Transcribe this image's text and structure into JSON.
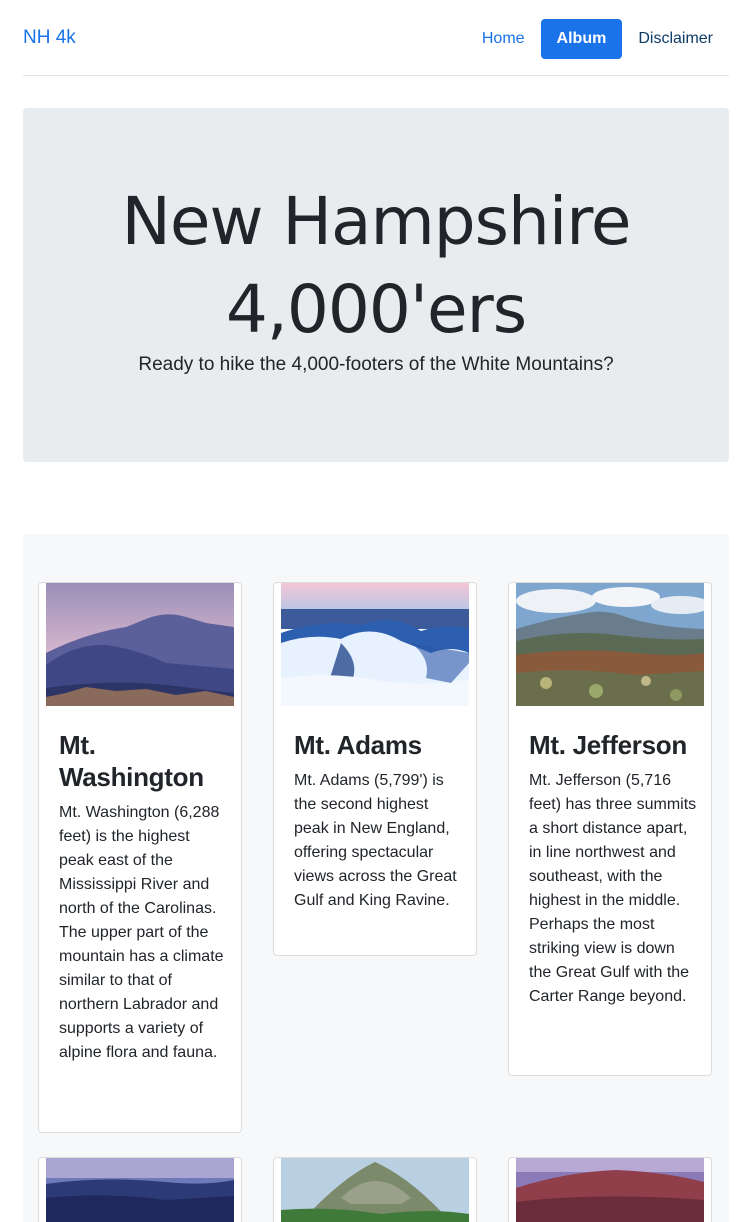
{
  "nav": {
    "brand": "NH 4k",
    "links": [
      {
        "label": "Home"
      },
      {
        "label": "Album"
      },
      {
        "label": "Disclaimer"
      }
    ],
    "active_link": "Album",
    "accent_color": "#1a73e8"
  },
  "hero": {
    "title_line1": "New Hampshire",
    "title_line2": "4,000'ers",
    "lead": "Ready to hike the 4,000-footers of the White Mountains?"
  },
  "album": {
    "cards": [
      {
        "title": "Mt. Washington",
        "text": "Mt. Washington (6,288 feet) is the highest peak east of the Mississippi River and north of the Carolinas. The upper part of the mountain has a climate similar to that of northern Labrador and supports a variety of alpine flora and fauna.",
        "image": "mountain-dusk-photo"
      },
      {
        "title": "Mt. Adams",
        "text": "Mt. Adams (5,799') is the second highest peak in New England, offering spectacular views across the Great Gulf and King Ravine.",
        "image": "snowy-mountain-photo"
      },
      {
        "title": "Mt. Jefferson",
        "text": "Mt. Jefferson (5,716 feet) has three summits a short distance apart, in line northwest and southeast, with the highest in the middle. Perhaps the most striking view is down the Great Gulf with the Carter Range beyond.",
        "image": "rocky-summit-photo"
      },
      {
        "image": "ridge-at-dusk-photo"
      },
      {
        "image": "green-peak-photo"
      },
      {
        "image": "red-summit-photo"
      }
    ]
  }
}
